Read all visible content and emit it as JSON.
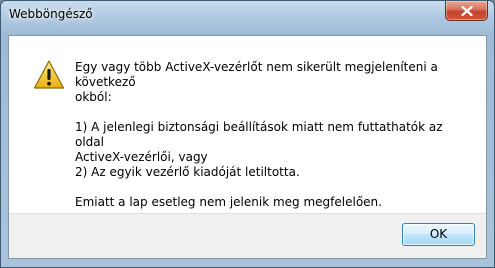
{
  "window": {
    "title": "Webböngésző"
  },
  "dialog": {
    "icon": "warning-icon",
    "message_lines": [
      "Egy vagy több ActiveX-vezérlőt nem sikerült megjeleníteni a következő",
      "okból:",
      "1) A jelenlegi biztonsági beállítások miatt nem futtathatók az oldal",
      "ActiveX-vezérlői, vagy",
      "2) Az egyik vezérlő kiadóját letiltotta.",
      "Emiatt a lap esetleg nem jelenik meg megfelelően."
    ]
  },
  "buttons": {
    "ok_label": "OK"
  },
  "colors": {
    "close_button": "#c7432b",
    "ok_button_border": "#3c7fb1",
    "warning_fill": "#f2c42a"
  }
}
